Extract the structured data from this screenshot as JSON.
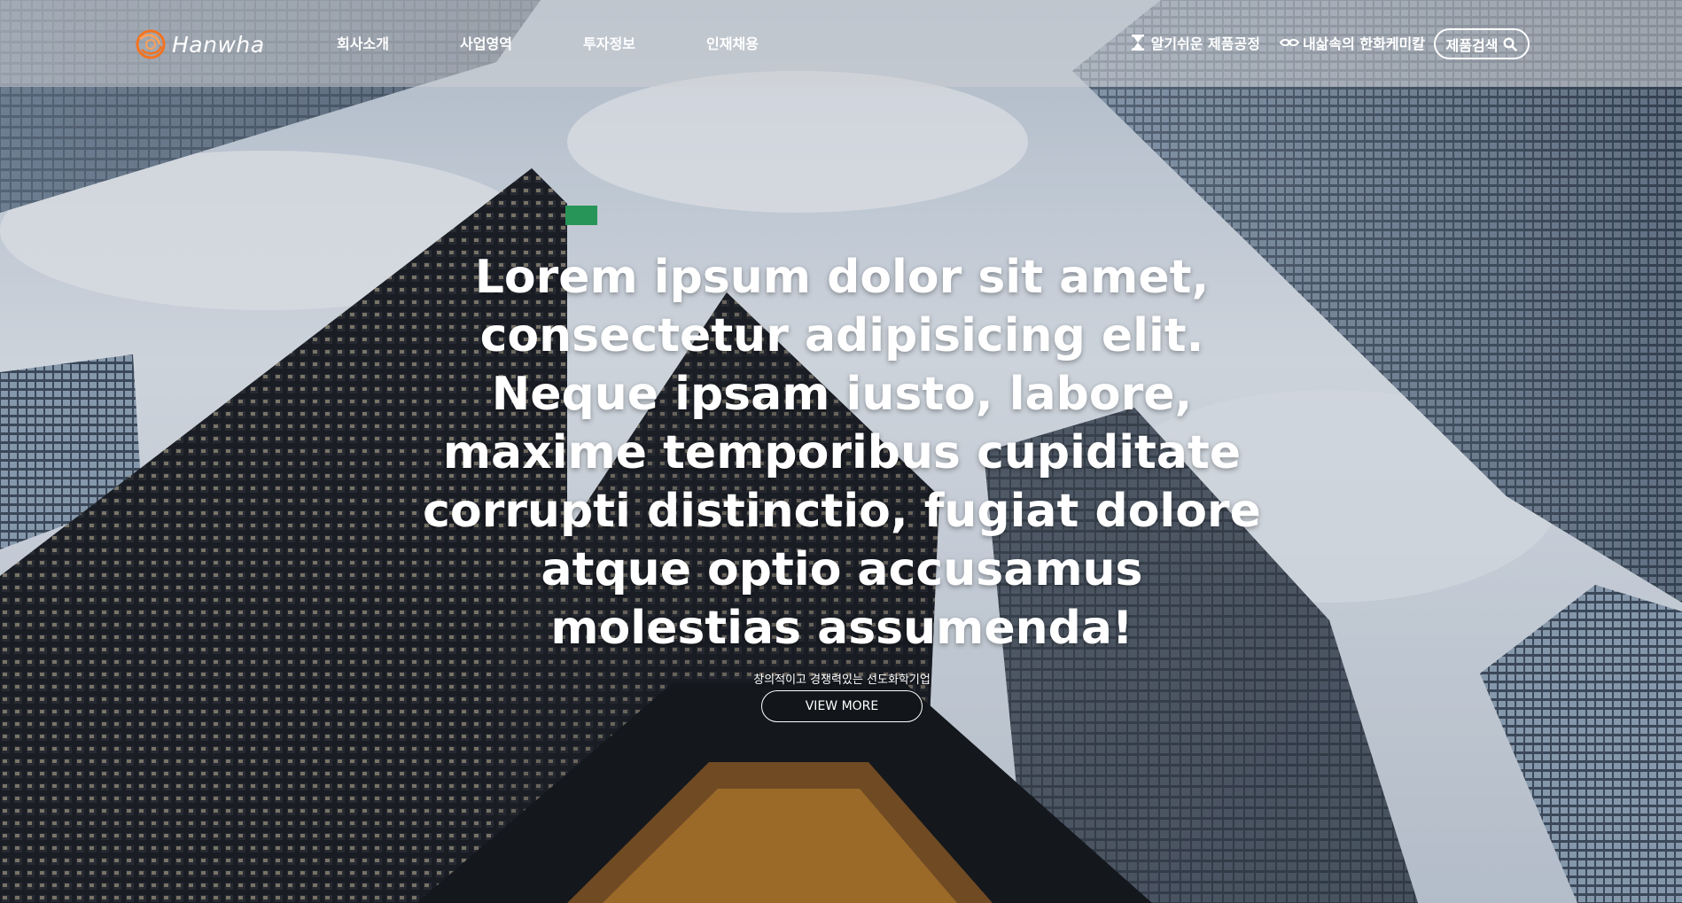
{
  "header": {
    "logo_text": "Hanwha",
    "nav": [
      "회사소개",
      "사업영역",
      "투자정보",
      "인재채용"
    ],
    "util_links": [
      {
        "label": "알기쉬운 제품공정",
        "icon": "hourglass-icon"
      },
      {
        "label": "내삶속의 한화케미칼",
        "icon": "handshake-icon"
      }
    ],
    "search_label": "제품검색",
    "search_icon": "search-icon"
  },
  "hero": {
    "title": "Lorem ipsum dolor sit amet, consectetur adipisicing elit. Neque ipsam iusto, labore, maxime temporibus cupiditate corrupti distinctio, fugiat dolore atque optio accusamus molestias assumenda!",
    "subtitle": "창의적이고 경쟁력있는 선도화학기업",
    "cta_label": "VIEW MORE"
  },
  "colors": {
    "brand_orange": "#f37321",
    "header_overlay": "#cdd0d4"
  }
}
